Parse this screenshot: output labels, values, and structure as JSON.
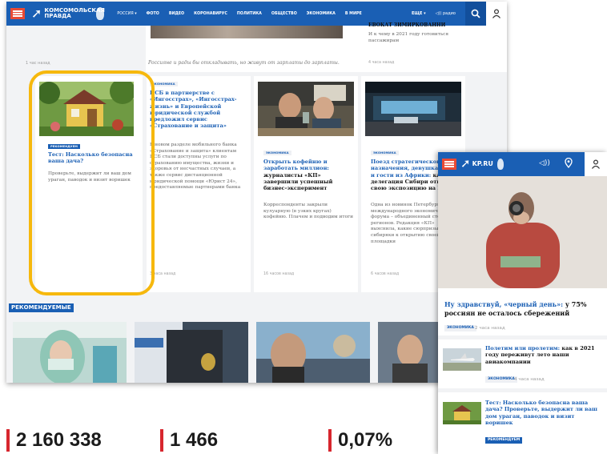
{
  "desktop": {
    "header": {
      "logo_line1": "КОМСОМОЛЬСКАЯ",
      "logo_line2": "ПРАВДА",
      "region": "РОССИЯ ▾",
      "nav": [
        "ФОТО",
        "ВИДЕО",
        "КОРОНАВИРУС",
        "ПОЛИТИКА",
        "ОБЩЕСТВО",
        "ЭКОНОМИКА",
        "В МИРЕ"
      ],
      "more": "ЕЩЕ ▾",
      "radio": "◁)) радио"
    },
    "top_row": {
      "left_time": "1 час назад",
      "middle_caption": "Россияне и рады бы откладывать, но живут от зарплаты до зарплаты.",
      "right_title": "ЕВОКАТ ЗИМИРКОВАННИ",
      "right_desc": "И к чему в 2021 году готовиться пассажирам",
      "right_time": "4 часа назад"
    },
    "cards": [
      {
        "tag": "РЕКОМЕНДУЕМ",
        "title": "Тест: Насколько безопасна ваша дача?",
        "desc": "Проверьте, выдержит ли ваш дом ураган, паводок и визит воришек"
      },
      {
        "tag": "ЭКОНОМИКА",
        "title": "ПСБ в партнерстве с «Ингосстрах», «Ингосстрах-жизнь» и Европейской юридической службой предложил сервис «Страхование и защита»",
        "desc": "В новом разделе мобильного банка «Страхование и защита» клиентам ПСБ стали доступны услуги по страхованию имущества, жизни и здоровья от несчастных случаев, а также сервис дистанционной юридической помощи «Юрист 24», предоставляемые партнерами банка",
        "time": "3 часа назад"
      },
      {
        "tag": "ЭКОНОМИКА",
        "title": "Открыть кофейню и заработать миллион:",
        "title_dark": "журналисты «КП» завершили успешный бизнес-эксперимент",
        "desc": "Корреспонденты закрыли кулуарную (в узких кругах) кофейню. Плачем и подводим итоги",
        "time": "16 часов назад"
      },
      {
        "tag": "ЭКОНОМИКА",
        "title": "Поезд стратегического назначения, девушка-робот и гости из Африки:",
        "title_dark": "как делегация Сибири открыла свою экспозицию на ПМЭФ",
        "desc": "Одна из новинок Петербургского международного экономического форума – объединенный стенд 10 регионов. Редакция «КП» выяснила, какие сюрпризы готовят сибиряки к открытию своей площадки",
        "time": "6 часов назад"
      }
    ],
    "recommended_title": "РЕКОМЕНДУЕМЫЕ"
  },
  "mobile": {
    "logo": "KP.RU",
    "radio_icon": "◁))",
    "headline_link": "Ну здравствуй, «черный день»:",
    "headline_dark": "у 75% россиян не осталось сбережений",
    "headline_tag": "ЭКОНОМИКА",
    "headline_time": "2 часа назад",
    "item1_link": "Полетим или пролетим:",
    "item1_dark": "как в 2021 году переживут лето наши авиакомпании",
    "item1_tag": "ЭКОНОМИКА",
    "item1_time": "4 часа назад",
    "item2_link": "Тест: Насколько безопасна ваша дача? Проверьте, выдержит ли ваш дом ураган, паводок и визит воришек",
    "item2_tag": "РЕКОМЕНДУЕМ"
  },
  "stats": [
    "2 160 338",
    "1 466",
    "0,07%"
  ],
  "colors": {
    "brand_blue": "#1a5fb4",
    "accent_red": "#e94a35",
    "highlight": "#f6b80d"
  }
}
